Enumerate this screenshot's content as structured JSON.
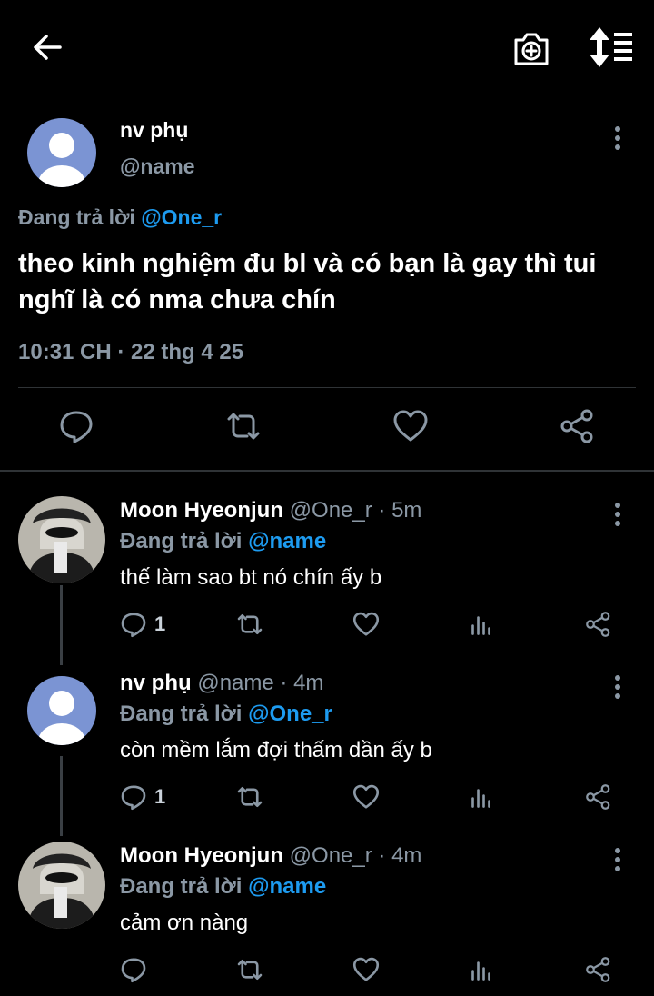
{
  "main_tweet": {
    "name": "nv phụ",
    "handle": "@name",
    "reply_prefix": "Đang trả lời",
    "reply_to": "@One_r",
    "text": "theo kinh nghiệm đu bl và có bạn là gay thì tui nghĩ là có nma chưa chín",
    "timestamp": "10:31 CH · 22 thg 4 25"
  },
  "replies": [
    {
      "name": "Moon Hyeonjun",
      "handle": "@One_r",
      "age": "· 5m",
      "reply_prefix": "Đang trả lời",
      "reply_to": "@name",
      "text": "thế làm sao bt nó chín ấy b",
      "reply_count": "1",
      "avatar": "photo"
    },
    {
      "name": "nv phụ",
      "handle": "@name",
      "age": "· 4m",
      "reply_prefix": "Đang trả lời",
      "reply_to": "@One_r",
      "text": "còn mềm lắm đợi thấm dần ấy b",
      "reply_count": "1",
      "avatar": "default"
    },
    {
      "name": "Moon Hyeonjun",
      "handle": "@One_r",
      "age": "· 4m",
      "reply_prefix": "Đang trả lời",
      "reply_to": "@name",
      "text": "cảm ơn nàng",
      "reply_count": "",
      "avatar": "photo"
    }
  ],
  "icons": {
    "top": [
      "back-arrow-icon",
      "camera-plus-icon",
      "sort-icon"
    ],
    "actions": [
      "reply-icon",
      "retweet-icon",
      "like-icon",
      "stats-icon",
      "share-icon"
    ]
  },
  "colors": {
    "background": "#000000",
    "accent": "#1d9bf0",
    "muted": "#8b98a5",
    "default_avatar": "#7b94d3"
  }
}
